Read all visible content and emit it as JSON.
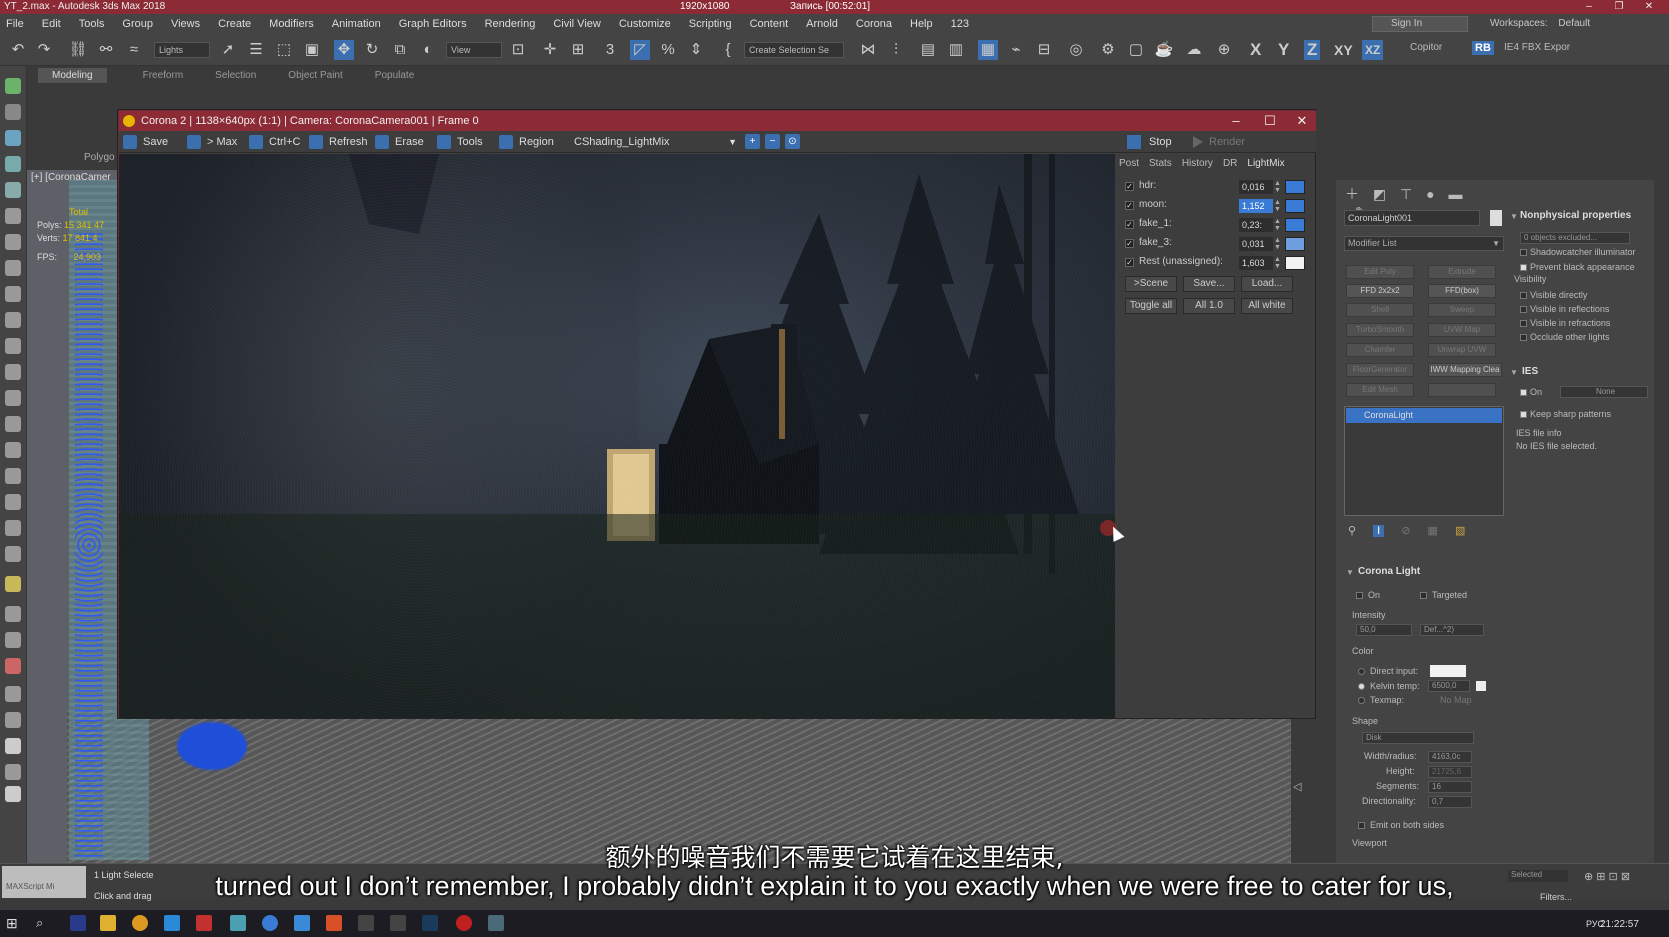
{
  "window": {
    "title": "YT_2.max - Autodesk 3ds Max 2018",
    "resolution": "1920x1080",
    "recording": "Запись [00:52:01]"
  },
  "menu": [
    "File",
    "Edit",
    "Tools",
    "Group",
    "Views",
    "Create",
    "Modifiers",
    "Animation",
    "Graph Editors",
    "Rendering",
    "Civil View",
    "Customize",
    "Scripting",
    "Content",
    "Arnold",
    "Corona",
    "Help",
    "123"
  ],
  "account": {
    "sign_in": "Sign In",
    "workspaces_label": "Workspaces:",
    "workspace": "Default"
  },
  "toolbar": {
    "filter": "Lights",
    "refcoord": "View",
    "selection_set": "Create Selection Se",
    "axis_x": "X",
    "axis_y": "Y",
    "axis_z": "Z",
    "axis_xy": "XY",
    "copitor": "Copitor",
    "rb": "RB",
    "fbx": "IE4 FBX Expor"
  },
  "ribbon": {
    "tabs": [
      "Modeling",
      "Freeform",
      "Selection",
      "Object Paint",
      "Populate"
    ],
    "active": "Modeling",
    "polygon": "Polygo"
  },
  "viewport": {
    "label": "[+] [CoronaCamer",
    "stats": {
      "total": "Total",
      "polys_label": "Polys:",
      "polys": "15 341 47",
      "verts_label": "Verts:",
      "verts": "17 841 4",
      "fps_label": "FPS:",
      "fps": "24,903"
    }
  },
  "corona_vfb": {
    "title": "Corona 2 | 1138×640px (1:1) | Camera: CoronaCamera001 | Frame 0",
    "toolbar": {
      "save": "Save",
      "to_max": "> Max",
      "copy": "Ctrl+C",
      "refresh": "Refresh",
      "erase": "Erase",
      "tools": "Tools",
      "region": "Region",
      "stop": "Stop",
      "render": "Render"
    },
    "shading": "CShading_LightMix",
    "tabs": [
      "Post",
      "Stats",
      "History",
      "DR",
      "LightMix"
    ],
    "active_tab": "LightMix",
    "lightmix": [
      {
        "name": "hdr:",
        "value": "0,016",
        "color": "#3a7bd5"
      },
      {
        "name": "moon:",
        "value": "1,152",
        "color": "#3a7bd5",
        "selected": true
      },
      {
        "name": "fake_1:",
        "value": "0,23:",
        "color": "#3a7bd5"
      },
      {
        "name": "fake_3:",
        "value": "0,031",
        "color": "#6f9fe0"
      },
      {
        "name": "Rest (unassigned):",
        "value": "1,603",
        "color": "#f2f2f2"
      }
    ],
    "buttons1": [
      ">Scene",
      "Save...",
      "Load..."
    ],
    "buttons2": [
      "Toggle all",
      "All 1.0",
      "All white"
    ]
  },
  "command_panel": {
    "object_name": "CoronaLight001",
    "modifier_list": "Modifier List",
    "modifiers": [
      [
        "Edit Poly",
        "Extrude"
      ],
      [
        "FFD 2x2x2",
        "FFD(box)"
      ],
      [
        "Shell",
        "Sweep"
      ],
      [
        "TurboSmooth",
        "UVW Map"
      ],
      [
        "Chamfer",
        "Unwrap UVW"
      ],
      [
        "FloorGenerator",
        "IWW Mapping Clea"
      ],
      [
        "Edit Mesh",
        ""
      ]
    ],
    "stack_item": "CoronaLight",
    "corona_light": {
      "title": "Corona Light",
      "on": "On",
      "targeted": "Targeted",
      "intensity_label": "Intensity",
      "intensity": "50,0",
      "intensity_unit": "Def...^2)",
      "color_label": "Color",
      "direct_input": "Direct input:",
      "kelvin": "Kelvin temp:",
      "kelvin_value": "6500,0",
      "texmap": "Texmap:",
      "texmap_value": "No Map",
      "shape_label": "Shape",
      "shape": "Disk",
      "width_label": "Width/radius:",
      "width": "4163,0c",
      "height_label": "Height:",
      "height": "21725,6",
      "segments_label": "Segments:",
      "segments": "16",
      "directionality_label": "Directionality:",
      "directionality": "0,7",
      "emit_both": "Emit on both sides",
      "viewport_label": "Viewport"
    },
    "nonphysical": {
      "title": "Nonphysical properties",
      "excluded": "0 objects excluded...",
      "shadowcatcher": "Shadowcatcher illuminator",
      "prevent_black": "Prevent black appearance",
      "visibility": "Visibility",
      "visible_directly": "Visible directly",
      "visible_reflections": "Visible in reflections",
      "visible_refractions": "Visible in refractions",
      "occlude": "Occlude other lights"
    },
    "ies": {
      "title": "IES",
      "on": "On",
      "none": "None",
      "keep_sharp": "Keep sharp patterns",
      "info_label": "IES file info",
      "info": "No IES file selected."
    }
  },
  "statusbar": {
    "maxscript": "MAXScript Mi",
    "line1": "1 Light Selecte",
    "line2": "Click and drag",
    "selected": "Selected",
    "filters": "Filters..."
  },
  "taskbar": {
    "lang": "РУС",
    "clock": "21:22:57"
  },
  "subtitles": {
    "cn": "额外的噪音我们不需要它试着在这里结束,",
    "en": "turned out  I don’t remember, I probably didn’t explain it to you exactly when we were free to cater for us,"
  }
}
